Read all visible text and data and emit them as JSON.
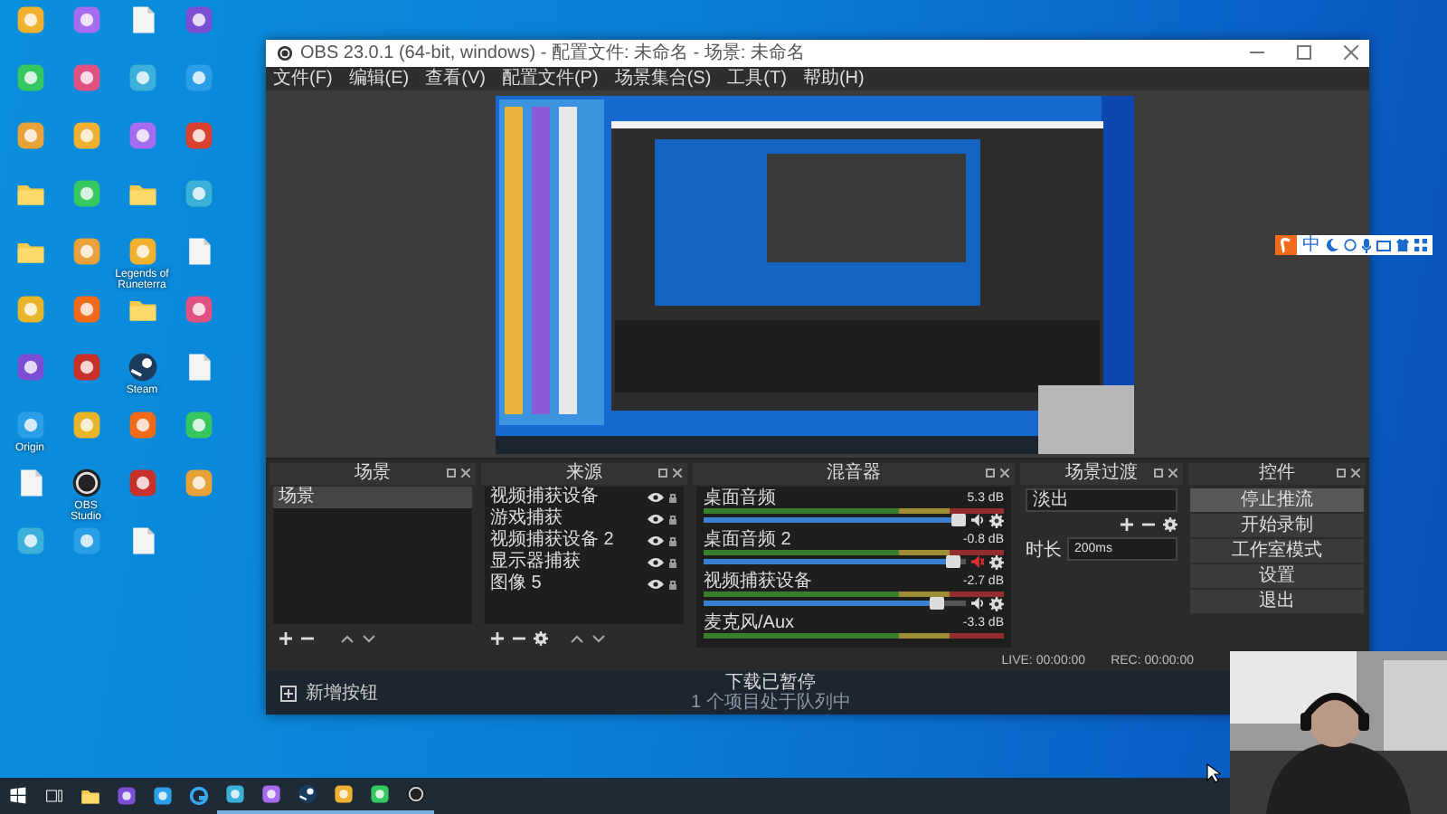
{
  "desktop": {
    "icons": [
      {
        "kind": "app"
      },
      {
        "kind": "app"
      },
      {
        "kind": "app"
      },
      {
        "kind": "folder"
      },
      {
        "kind": "folder"
      },
      {
        "kind": "app"
      },
      {
        "kind": "app"
      },
      {
        "kind": "app",
        "label": "Origin"
      },
      {
        "kind": "file"
      },
      {
        "kind": "app"
      },
      {
        "kind": "app"
      },
      {
        "kind": "app"
      },
      {
        "kind": "app"
      },
      {
        "kind": "app"
      },
      {
        "kind": "app"
      },
      {
        "kind": "app"
      },
      {
        "kind": "app"
      },
      {
        "kind": "app"
      },
      {
        "kind": "obs",
        "label": "OBS Studio"
      },
      {
        "kind": "app"
      },
      {
        "kind": "file"
      },
      {
        "kind": "app"
      },
      {
        "kind": "app"
      },
      {
        "kind": "folder"
      },
      {
        "kind": "app",
        "label": "Legends of Runeterra"
      },
      {
        "kind": "folder"
      },
      {
        "kind": "steam",
        "label": "Steam"
      },
      {
        "kind": "app"
      },
      {
        "kind": "app"
      },
      {
        "kind": "file"
      },
      {
        "kind": "app"
      },
      {
        "kind": "app"
      },
      {
        "kind": "app"
      },
      {
        "kind": "app"
      },
      {
        "kind": "file"
      },
      {
        "kind": "app"
      },
      {
        "kind": "file"
      },
      {
        "kind": "app"
      },
      {
        "kind": "app"
      }
    ]
  },
  "obs": {
    "title": "OBS 23.0.1 (64-bit, windows) - 配置文件: 未命名 - 场景: 未命名",
    "menu": [
      "文件(F)",
      "编辑(E)",
      "查看(V)",
      "配置文件(P)",
      "场景集合(S)",
      "工具(T)",
      "帮助(H)"
    ],
    "scenes": {
      "title": "场景",
      "items": [
        {
          "label": "场景",
          "selected": true
        }
      ]
    },
    "sources": {
      "title": "来源",
      "items": [
        {
          "label": "视频捕获设备",
          "visible": true
        },
        {
          "label": "游戏捕获",
          "visible": true
        },
        {
          "label": "视频捕获设备 2",
          "visible": true
        },
        {
          "label": "显示器捕获",
          "visible": true
        },
        {
          "label": "图像 5",
          "visible": true
        }
      ]
    },
    "mixer": {
      "title": "混音器",
      "channels": [
        {
          "name": "桌面音频",
          "reading": "5.3 dB",
          "level": 0.97,
          "muted": false
        },
        {
          "name": "桌面音频 2",
          "reading": "-0.8 dB",
          "level": 0.95,
          "muted": true
        },
        {
          "name": "视频捕获设备",
          "reading": "-2.7 dB",
          "level": 0.89,
          "muted": false
        },
        {
          "name": "麦克风/Aux",
          "reading": "-3.3 dB"
        }
      ]
    },
    "transitions": {
      "title": "场景过渡",
      "transition": "淡出",
      "duration_label": "时长",
      "duration": "200ms"
    },
    "controls": {
      "title": "控件",
      "buttons": [
        {
          "label": "停止推流",
          "active": true
        },
        {
          "label": "开始录制",
          "active": false
        },
        {
          "label": "工作室模式",
          "active": false
        },
        {
          "label": "设置",
          "active": false
        },
        {
          "label": "退出",
          "active": false
        }
      ]
    },
    "status": {
      "live": "LIVE: 00:00:00",
      "rec": "REC: 00:00:00"
    }
  },
  "notification": {
    "button": "新增按钮",
    "title": "下载已暂停",
    "subtitle": "1 个项目处于队列中"
  },
  "ime": {
    "mode": "中"
  },
  "taskbar": {
    "items": [
      {
        "kind": "start",
        "running": false
      },
      {
        "kind": "task-view",
        "running": false
      },
      {
        "kind": "folder",
        "running": false
      },
      {
        "kind": "app",
        "running": false
      },
      {
        "kind": "app",
        "running": false
      },
      {
        "kind": "browser",
        "running": false
      },
      {
        "kind": "app",
        "running": true
      },
      {
        "kind": "app",
        "running": true
      },
      {
        "kind": "steam",
        "running": true
      },
      {
        "kind": "app",
        "running": true
      },
      {
        "kind": "app",
        "running": true
      },
      {
        "kind": "obs",
        "running": true
      }
    ]
  }
}
